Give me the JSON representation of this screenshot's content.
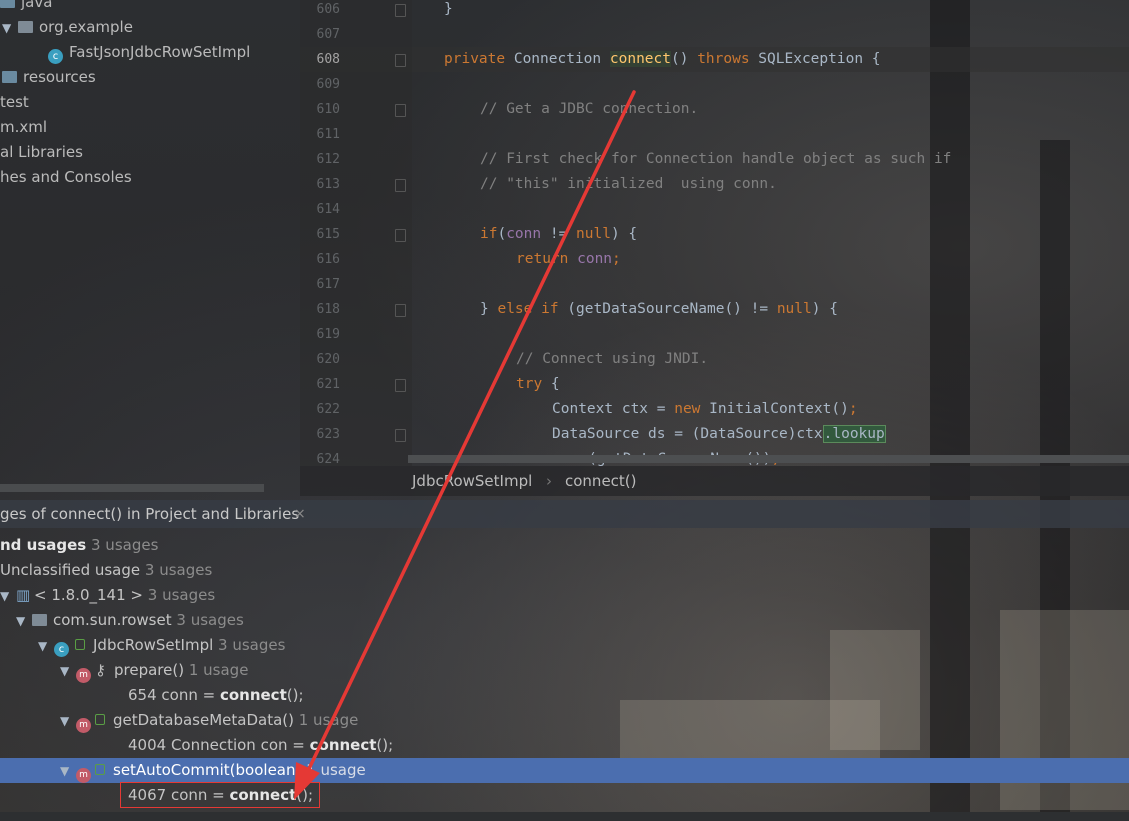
{
  "project_tree": {
    "items": [
      {
        "label": "java",
        "kind": "folder"
      },
      {
        "label": "org.example",
        "kind": "package"
      },
      {
        "label": "FastJsonJdbcRowSetImpl",
        "kind": "class"
      },
      {
        "label": "resources",
        "kind": "folder"
      },
      {
        "label": "test",
        "kind": "folder"
      },
      {
        "label": "m.xml",
        "kind": "file"
      },
      {
        "label": "al Libraries",
        "kind": "node"
      },
      {
        "label": "hes and Consoles",
        "kind": "node"
      }
    ]
  },
  "editor": {
    "line_numbers": [
      "606",
      "607",
      "608",
      "609",
      "610",
      "611",
      "612",
      "613",
      "614",
      "615",
      "616",
      "617",
      "618",
      "619",
      "620",
      "621",
      "622",
      "623",
      "624"
    ],
    "current_line": "608",
    "code": {
      "l606_brace": "}",
      "l608_private": "private",
      "l608_type": " Connection ",
      "l608_method": "connect",
      "l608_parens": "() ",
      "l608_throws": "throws",
      "l608_rest": " SQLException {",
      "l610": "// Get a JDBC connection.",
      "l612": "// First check for Connection handle object as such if",
      "l613": "// \"this\" initialized  using conn.",
      "l615_if": "if",
      "l615_paren": "(",
      "l615_conn": "conn",
      "l615_ne": " != ",
      "l615_null": "null",
      "l615_end": ") {",
      "l616_return": "return",
      "l616_conn": " conn",
      "l616_semi": ";",
      "l618_brace": "} ",
      "l618_else": "else if",
      "l618_call": " (getDataSourceName() != ",
      "l618_null": "null",
      "l618_end": ") {",
      "l620": "// Connect using JNDI.",
      "l621_try": "try",
      "l621_brace": " {",
      "l622_a": "Context ctx = ",
      "l622_new": "new",
      "l622_b": " InitialContext()",
      "l622_semi": ";",
      "l623_a": "DataSource ds = (DataSource)ctx",
      "l623_sel": ".lookup",
      "l624": "(getDataSourceName())",
      "l624_semi": ";"
    }
  },
  "breadcrumb": {
    "class_name": "JdbcRowSetImpl",
    "separator": "›",
    "method": "connect()"
  },
  "find_panel": {
    "title": "ges of connect() in Project and Libraries",
    "close": "×",
    "rows": {
      "found_label": "nd usages",
      "found_count": "3 usages",
      "unclassified_label": "Unclassified usage",
      "unclassified_count": "3 usages",
      "jdk_label": "< 1.8.0_141 >",
      "jdk_count": "3 usages",
      "pkg_label": "com.sun.rowset",
      "pkg_count": "3 usages",
      "class_label": "JdbcRowSetImpl",
      "class_count": "3 usages",
      "prepare_label": "prepare()",
      "prepare_count": "1 usage",
      "prepare_usage_prefix": "654 conn = ",
      "prepare_usage_bold": "connect",
      "prepare_usage_suffix": "();",
      "meta_label": "getDatabaseMetaData()",
      "meta_count": "1 usage",
      "meta_usage_prefix": "4004 Connection con = ",
      "meta_usage_bold": "connect",
      "meta_usage_suffix": "();",
      "auto_label": "setAutoCommit(boolean)",
      "auto_count": "1 usage",
      "auto_usage_prefix": "4067 conn = ",
      "auto_usage_bold": "connect",
      "auto_usage_suffix": "();"
    }
  },
  "colors": {
    "selection": "#4b6eaf",
    "annotation": "#e53935",
    "keyword": "#cc7832",
    "method": "#ffc66d",
    "field": "#9876aa",
    "comment": "#808080"
  }
}
